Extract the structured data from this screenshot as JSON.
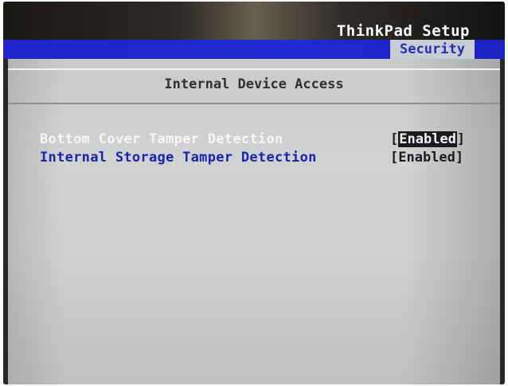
{
  "window": {
    "title": "ThinkPad Setup"
  },
  "tabs": {
    "active_label": "Security"
  },
  "page": {
    "title": "Internal Device Access"
  },
  "settings": [
    {
      "label": "Bottom Cover Tamper Detection",
      "value": "Enabled",
      "selected": true
    },
    {
      "label": "Internal Storage Tamper Detection",
      "value": "Enabled",
      "selected": false
    }
  ],
  "colors": {
    "tab_bar": "#2029d2",
    "active_tab_bg": "#c8ccd4",
    "panel_bg": "#cfd0d0",
    "selected_text": "#f7f7f7",
    "item_text": "#1b23b0"
  }
}
